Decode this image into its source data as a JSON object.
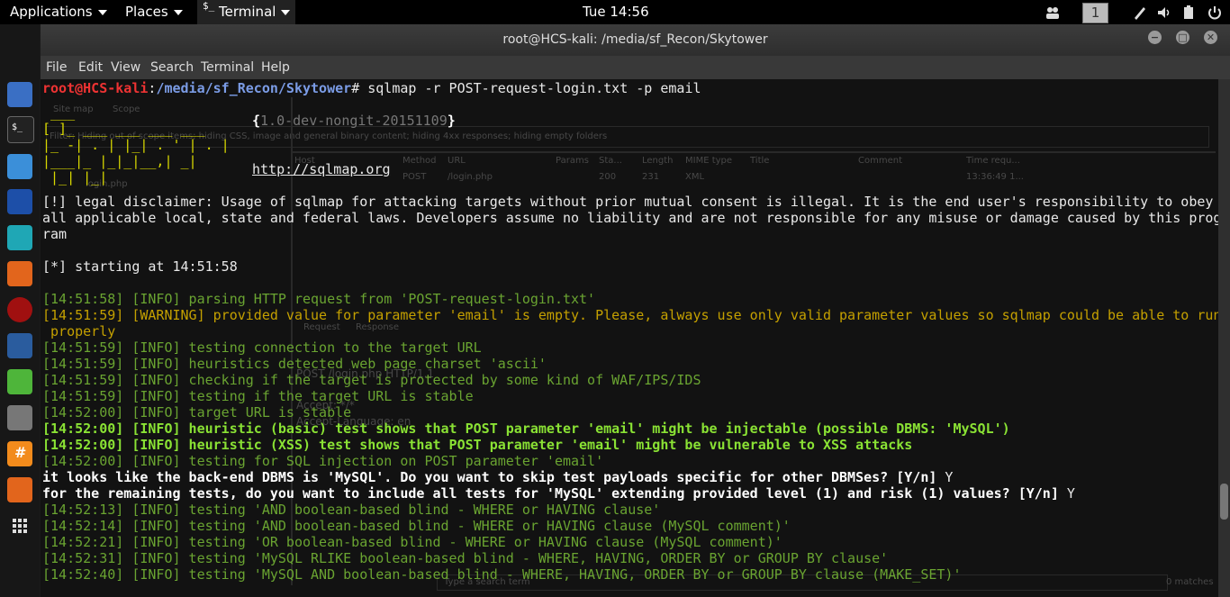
{
  "topbar": {
    "applications": "Applications",
    "places": "Places",
    "terminal_app": "Terminal",
    "clock": "Tue 14:56",
    "workspace": "1"
  },
  "window": {
    "title": "root@HCS-kali: /media/sf_Recon/Skytower",
    "minimize": "−",
    "maximize": "□",
    "close": "✕"
  },
  "menu": [
    "File",
    "Edit",
    "View",
    "Search",
    "Terminal",
    "Help"
  ],
  "terminal": {
    "prompt_user": "root@HCS-kali",
    "prompt_sep": ":",
    "prompt_path": "/media/sf_Recon/Skytower",
    "prompt_cmd": "# sqlmap -r POST-request-login.txt -p email",
    "logo1": " ___",
    "logo2": "[ ]_ ___ ___ ___ ___",
    "logo3": "|_ -| . | |_| . ' | . |",
    "logo4": "|___|_ |_|_|__,| _|",
    "logo5": " |_| |_|",
    "version_open": "{",
    "version": "1.0-dev-nongit-20151109",
    "version_close": "}",
    "url": "http://sqlmap.org",
    "disclaimer1": "[!] legal disclaimer: Usage of sqlmap for attacking targets without prior mutual consent is illegal. It is the end user's responsibility to obey",
    "disclaimer2": "all applicable local, state and federal laws. Developers assume no liability and are not responsible for any misuse or damage caused by this prog",
    "disclaimer3": "ram",
    "starting": "[*] starting at 14:51:58",
    "l1": "[14:51:58] [INFO] parsing HTTP request from 'POST-request-login.txt'",
    "l2": "[14:51:59] [WARNING] provided value for parameter 'email' is empty. Please, always use only valid parameter values so sqlmap could be able to run",
    "l2b": " properly",
    "l3": "[14:51:59] [INFO] testing connection to the target URL",
    "l4": "[14:51:59] [INFO] heuristics detected web page charset 'ascii'",
    "l5": "[14:51:59] [INFO] checking if the target is protected by some kind of WAF/IPS/IDS",
    "l6": "[14:51:59] [INFO] testing if the target URL is stable",
    "l7": "[14:52:00] [INFO] target URL is stable",
    "l8": "[14:52:00] [INFO] heuristic (basic) test shows that POST parameter 'email' might be injectable (possible DBMS: 'MySQL')",
    "l9": "[14:52:00] [INFO] heuristic (XSS) test shows that POST parameter 'email' might be vulnerable to XSS attacks",
    "l10": "[14:52:00] [INFO] testing for SQL injection on POST parameter 'email'",
    "q1": "it looks like the back-end DBMS is 'MySQL'. Do you want to skip test payloads specific for other DBMSes? [Y/n]",
    "q1a": " Y",
    "q2": "for the remaining tests, do you want to include all tests for 'MySQL' extending provided level (1) and risk (1) values? [Y/n]",
    "q2a": " Y",
    "l11": "[14:52:13] [INFO] testing 'AND boolean-based blind - WHERE or HAVING clause'",
    "l12": "[14:52:14] [INFO] testing 'AND boolean-based blind - WHERE or HAVING clause (MySQL comment)'",
    "l13": "[14:52:21] [INFO] testing 'OR boolean-based blind - WHERE or HAVING clause (MySQL comment)'",
    "l14": "[14:52:31] [INFO] testing 'MySQL RLIKE boolean-based blind - WHERE, HAVING, ORDER BY or GROUP BY clause'",
    "l15": "[14:52:40] [INFO] testing 'MySQL AND boolean-based blind - WHERE, HAVING, ORDER BY or GROUP BY clause (MAKE_SET)'"
  },
  "background_window": {
    "tab_sitemap": "Site map",
    "tab_scope": "Scope",
    "filter": "Filter: Hiding out of scope items; hiding CSS, image and general binary content; hiding 4xx responses; hiding empty folders",
    "cols": [
      "Host",
      "Method",
      "URL",
      "Params",
      "Sta...",
      "Length",
      "MIME type",
      "Title",
      "Comment",
      "Time requ..."
    ],
    "row": [
      "POST",
      "/login.php",
      "200",
      "231",
      "XML",
      "13:36:49 1..."
    ],
    "tree_item": "login.php",
    "tab_request": "Request",
    "tab_response": "Response",
    "req1": "POST /login.php HTTP/1.1",
    "req2": "Accept: */*",
    "req3": "Accept-Language: en",
    "search_ph": "Type a search term",
    "matches": "0 matches"
  }
}
